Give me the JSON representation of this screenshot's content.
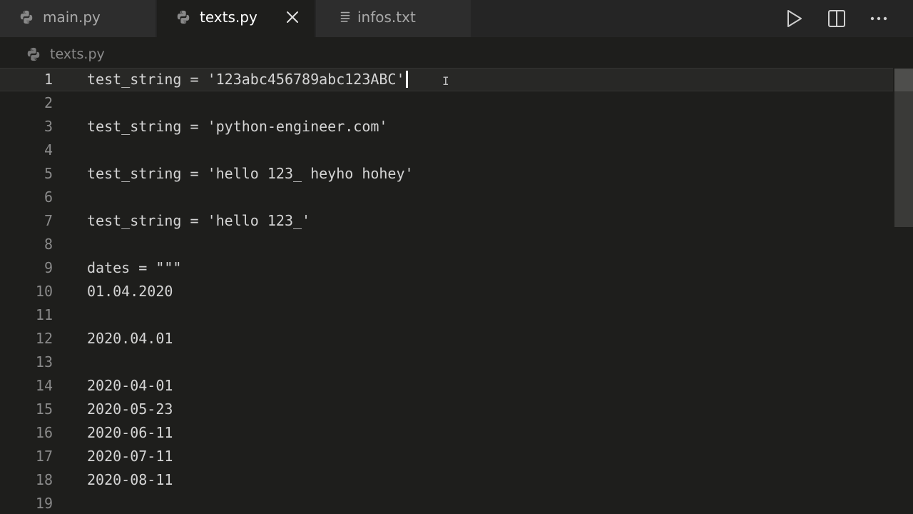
{
  "tabs": [
    {
      "label": "main.py",
      "icon": "python-icon",
      "active": false
    },
    {
      "label": "texts.py",
      "icon": "python-icon",
      "active": true
    },
    {
      "label": "infos.txt",
      "icon": "text-file-icon",
      "active": false
    }
  ],
  "toolbar": {
    "run_icon": "play-icon",
    "split_icon": "split-editor-icon",
    "more_icon": "more-actions-icon"
  },
  "breadcrumb": {
    "file": "texts.py",
    "icon": "python-icon"
  },
  "editor": {
    "current_line": 1,
    "lines": [
      {
        "number": "1",
        "text": "test_string = '123abc456789abc123ABC'"
      },
      {
        "number": "2",
        "text": ""
      },
      {
        "number": "3",
        "text": "test_string = 'python-engineer.com'"
      },
      {
        "number": "4",
        "text": ""
      },
      {
        "number": "5",
        "text": "test_string = 'hello 123_ heyho hohey'"
      },
      {
        "number": "6",
        "text": ""
      },
      {
        "number": "7",
        "text": "test_string = 'hello 123_'"
      },
      {
        "number": "8",
        "text": ""
      },
      {
        "number": "9",
        "text": "dates = \"\"\""
      },
      {
        "number": "10",
        "text": "01.04.2020"
      },
      {
        "number": "11",
        "text": ""
      },
      {
        "number": "12",
        "text": "2020.04.01"
      },
      {
        "number": "13",
        "text": ""
      },
      {
        "number": "14",
        "text": "2020-04-01"
      },
      {
        "number": "15",
        "text": "2020-05-23"
      },
      {
        "number": "16",
        "text": "2020-06-11"
      },
      {
        "number": "17",
        "text": "2020-07-11"
      },
      {
        "number": "18",
        "text": "2020-08-11"
      },
      {
        "number": "19",
        "text": ""
      }
    ]
  },
  "colors": {
    "editor_background": "#1e1e1c",
    "tabbar_background": "#252525",
    "inactive_tab": "#2d2d2d",
    "python_icon": "#8a8a8a",
    "text": "#d4d4d4"
  }
}
